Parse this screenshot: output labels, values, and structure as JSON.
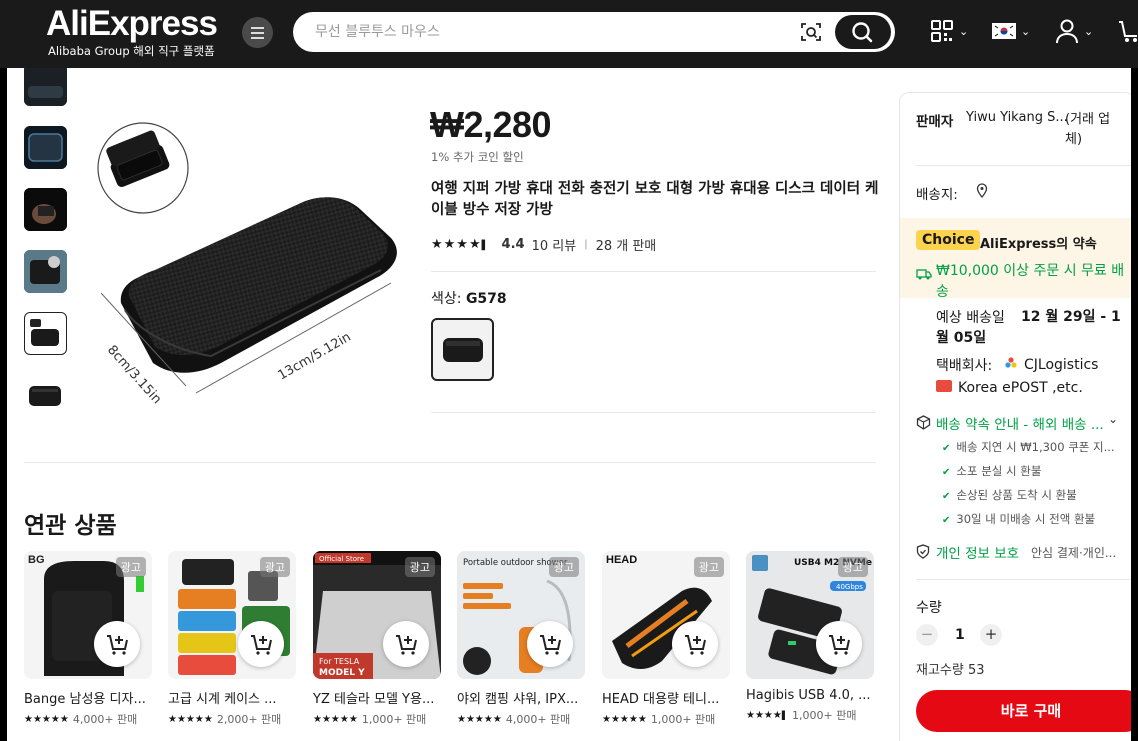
{
  "header": {
    "logo": "AliExpress",
    "logo_sub": "Alibaba Group 해외 직구 플랫폼",
    "search_placeholder": "무선 블루투스 마우스",
    "colors": {
      "bg": "#1a1a1a",
      "accent": "#e50914"
    }
  },
  "product": {
    "price": "₩2,280",
    "coin_discount": "1% 추가 코인 할인",
    "title": "여행 지퍼 가방 휴대 전화 충전기 보호 대형 가방 휴대용 디스크 데이터 케이블 방수 저장 가방",
    "rating": "4.4",
    "reviews": "10 리뷰",
    "sold": "28 개 판매",
    "color_label": "색상:",
    "color_value": "G578",
    "dim_label_1": "8cm/3.15in",
    "dim_label_2": "13cm/5.12in"
  },
  "related": {
    "title": "연관 상품",
    "items": [
      {
        "name": "Bange 남성용 디자...",
        "sold": "4,000+ 판매",
        "ad": "광고"
      },
      {
        "name": "고급 시계 케이스 ...",
        "sold": "2,000+ 판매",
        "ad": "광고"
      },
      {
        "name": "YZ 테슬라 모델 Y용...",
        "sold": "1,000+ 판매",
        "ad": "광고"
      },
      {
        "name": "야외 캠핑 샤워, IPX...",
        "sold": "4,000+ 판매",
        "ad": "광고"
      },
      {
        "name": "HEAD 대용량 테니...",
        "sold": "1,000+ 판매",
        "ad": "광고"
      },
      {
        "name": "Hagibis USB 4.0, ...",
        "sold": "1,000+ 판매",
        "ad": "광고"
      }
    ],
    "img_text": {
      "brand1": "BG",
      "store": "Official Store",
      "tesla": "For TESLA",
      "model": "MODEL Y",
      "shower": "Portable outdoor shower",
      "head": "HEAD",
      "usb": "USB4 M2 NVMe",
      "usb_speed": "40Gbps"
    }
  },
  "panel": {
    "seller_label": "판매자",
    "seller_name": "Yiwu Yikang S...",
    "seller_type": "(거래 업체)",
    "ship_label": "배송지:",
    "choice": "Choice",
    "promise": "AliExpress의 약속",
    "free_ship": "₩10,000 이상 주문 시 무료 배송",
    "eta_label": "예상 배송일",
    "eta": "12 월 29일 - 1 월 05일",
    "carrier_label": "택배회사:",
    "carrier1": "CJLogistics",
    "carrier2": "Korea ePOST ,etc.",
    "guarantee": "배송 약속 안내 - 해외 배송 ...",
    "checks": [
      "배송 지연 시 ₩1,300 쿠폰 지...",
      "소포 분실 시 환불",
      "손상된 상품 도착 시 환불",
      "30일 내 미배송 시 전액 환불"
    ],
    "privacy": "개인 정보 보호",
    "privacy_sub": "안심 결제·개인...",
    "qty_label": "수량",
    "qty": "1",
    "stock": "재고수량 53",
    "buy": "바로 구매"
  }
}
